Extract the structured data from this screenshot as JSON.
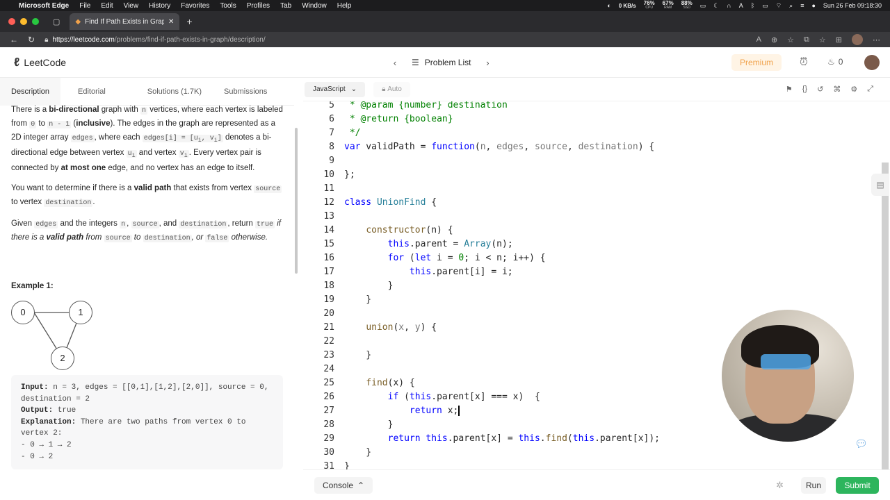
{
  "menubar": {
    "apple": "",
    "app_name": "Microsoft Edge",
    "items": [
      "File",
      "Edit",
      "View",
      "History",
      "Favorites",
      "Tools",
      "Profiles",
      "Tab",
      "Window",
      "Help"
    ],
    "stats": [
      {
        "value": "0 KB/s",
        "label": ""
      },
      {
        "value": "76%",
        "label": "CPU"
      },
      {
        "value": "67%",
        "label": "RAM"
      },
      {
        "value": "88%",
        "label": "SSD"
      }
    ],
    "clock": "Sun 26 Feb  09:18:30"
  },
  "browser": {
    "tab_title": "Find If Path Exists in Graph - L",
    "url_host": "https://leetcode.com",
    "url_path": "/problems/find-if-path-exists-in-graph/description/"
  },
  "header": {
    "logo_text": "LeetCode",
    "problem_list": "Problem List",
    "premium": "Premium",
    "streak": "0"
  },
  "left": {
    "tabs": [
      "Description",
      "Editorial",
      "Solutions (1.7K)",
      "Submissions"
    ],
    "p1": {
      "a": "There is a ",
      "b": "bi-directional",
      "c": " graph with ",
      "n": "n",
      "d": " vertices, where each vertex is labeled from ",
      "zero": "0",
      "e": " to ",
      "nm1": "n - 1",
      "f": " (",
      "incl": "inclusive",
      "g": "). The edges in the graph are represented as a 2D integer array ",
      "edges": "edges",
      "h": ", where each ",
      "edgei": "edges[i] = [u",
      "i1": "i",
      "comma": ", v",
      "i2": "i",
      "close": "]",
      "j": " denotes a bi-directional edge between vertex ",
      "u": "u",
      "ui": "i",
      "k": " and vertex ",
      "v": "v",
      "vi": "i",
      "l": ". Every vertex pair is connected by ",
      "atmost": "at most one",
      "m": " edge, and no vertex has an edge to itself."
    },
    "p2": {
      "a": "You want to determine if there is a ",
      "vp": "valid path",
      "b": " that exists from vertex ",
      "source": "source",
      "c": " to vertex ",
      "dest": "destination",
      "d": "."
    },
    "p3": {
      "a": "Given ",
      "edges": "edges",
      "b": " and the integers ",
      "n": "n",
      "c": ", ",
      "source": "source",
      "d": ", and ",
      "dest": "destination",
      "e": ", return ",
      "true": "true",
      "f": " if there is a ",
      "vp": "valid path",
      "g": " from ",
      "source2": "source",
      "h": " to ",
      "dest2": "destination",
      "i": ", or ",
      "false": "false",
      "j": " otherwise."
    },
    "example_title": "Example 1:",
    "graph_nodes": [
      "0",
      "1",
      "2"
    ],
    "io": {
      "in_label": "Input:",
      "in_val": " n = 3, edges = [[0,1],[1,2],[2,0]], source = 0, destination = 2",
      "out_label": "Output:",
      "out_val": " true",
      "exp_label": "Explanation:",
      "exp_val": " There are two paths from vertex 0 to vertex 2:",
      "path1": "- 0 → 1 → 2",
      "path2": "- 0 → 2"
    }
  },
  "editor": {
    "language": "JavaScript",
    "mode": "Auto",
    "lines": [
      {
        "n": "5",
        "parts": [
          {
            "t": " * ",
            "c": "cm"
          },
          {
            "t": "@param",
            "c": "cm"
          },
          {
            "t": " {number} destination",
            "c": "cm"
          }
        ]
      },
      {
        "n": "6",
        "parts": [
          {
            "t": " * ",
            "c": "cm"
          },
          {
            "t": "@return",
            "c": "cm"
          },
          {
            "t": " {boolean}",
            "c": "cm"
          }
        ]
      },
      {
        "n": "7",
        "parts": [
          {
            "t": " */",
            "c": "cm"
          }
        ]
      },
      {
        "n": "8",
        "parts": [
          {
            "t": "var",
            "c": "k"
          },
          {
            "t": " validPath = ",
            "c": ""
          },
          {
            "t": "function",
            "c": "k"
          },
          {
            "t": "(",
            "c": ""
          },
          {
            "t": "n",
            "c": "pa"
          },
          {
            "t": ", ",
            "c": ""
          },
          {
            "t": "edges",
            "c": "pa"
          },
          {
            "t": ", ",
            "c": ""
          },
          {
            "t": "source",
            "c": "pa"
          },
          {
            "t": ", ",
            "c": ""
          },
          {
            "t": "destination",
            "c": "pa"
          },
          {
            "t": ") {",
            "c": ""
          }
        ]
      },
      {
        "n": "9",
        "parts": []
      },
      {
        "n": "10",
        "parts": [
          {
            "t": "};",
            "c": ""
          }
        ]
      },
      {
        "n": "11",
        "parts": []
      },
      {
        "n": "12",
        "parts": [
          {
            "t": "class",
            "c": "k"
          },
          {
            "t": " ",
            "c": ""
          },
          {
            "t": "UnionFind",
            "c": "ty"
          },
          {
            "t": " {",
            "c": ""
          }
        ]
      },
      {
        "n": "13",
        "parts": []
      },
      {
        "n": "14",
        "parts": [
          {
            "t": "    ",
            "c": ""
          },
          {
            "t": "constructor",
            "c": "f"
          },
          {
            "t": "(n) {",
            "c": ""
          }
        ]
      },
      {
        "n": "15",
        "parts": [
          {
            "t": "        ",
            "c": ""
          },
          {
            "t": "this",
            "c": "k"
          },
          {
            "t": ".parent = ",
            "c": ""
          },
          {
            "t": "Array",
            "c": "ty"
          },
          {
            "t": "(n);",
            "c": ""
          }
        ]
      },
      {
        "n": "16",
        "parts": [
          {
            "t": "        ",
            "c": ""
          },
          {
            "t": "for",
            "c": "k"
          },
          {
            "t": " (",
            "c": ""
          },
          {
            "t": "let",
            "c": "k"
          },
          {
            "t": " i = ",
            "c": ""
          },
          {
            "t": "0",
            "c": "cm"
          },
          {
            "t": "; i < n; i++) {",
            "c": ""
          }
        ]
      },
      {
        "n": "17",
        "parts": [
          {
            "t": "            ",
            "c": ""
          },
          {
            "t": "this",
            "c": "k"
          },
          {
            "t": ".parent[i] = i;",
            "c": ""
          }
        ]
      },
      {
        "n": "18",
        "parts": [
          {
            "t": "        }",
            "c": ""
          }
        ]
      },
      {
        "n": "19",
        "parts": [
          {
            "t": "    }",
            "c": ""
          }
        ]
      },
      {
        "n": "20",
        "parts": []
      },
      {
        "n": "21",
        "parts": [
          {
            "t": "    ",
            "c": ""
          },
          {
            "t": "union",
            "c": "f"
          },
          {
            "t": "(",
            "c": ""
          },
          {
            "t": "x",
            "c": "pa"
          },
          {
            "t": ", ",
            "c": ""
          },
          {
            "t": "y",
            "c": "pa"
          },
          {
            "t": ") {",
            "c": ""
          }
        ]
      },
      {
        "n": "22",
        "parts": []
      },
      {
        "n": "23",
        "parts": [
          {
            "t": "    }",
            "c": ""
          }
        ]
      },
      {
        "n": "24",
        "parts": []
      },
      {
        "n": "25",
        "parts": [
          {
            "t": "    ",
            "c": ""
          },
          {
            "t": "find",
            "c": "f"
          },
          {
            "t": "(x) {",
            "c": ""
          }
        ]
      },
      {
        "n": "26",
        "parts": [
          {
            "t": "        ",
            "c": ""
          },
          {
            "t": "if",
            "c": "k"
          },
          {
            "t": " (",
            "c": ""
          },
          {
            "t": "this",
            "c": "k"
          },
          {
            "t": ".parent[x] === x)  {",
            "c": ""
          }
        ]
      },
      {
        "n": "27",
        "parts": [
          {
            "t": "            ",
            "c": ""
          },
          {
            "t": "return",
            "c": "k"
          },
          {
            "t": " x;",
            "c": ""
          }
        ]
      },
      {
        "n": "28",
        "parts": [
          {
            "t": "        }",
            "c": ""
          }
        ]
      },
      {
        "n": "29",
        "parts": [
          {
            "t": "        ",
            "c": ""
          },
          {
            "t": "return",
            "c": "k"
          },
          {
            "t": " ",
            "c": ""
          },
          {
            "t": "this",
            "c": "k"
          },
          {
            "t": ".parent[x] = ",
            "c": ""
          },
          {
            "t": "this",
            "c": "k"
          },
          {
            "t": ".",
            "c": ""
          },
          {
            "t": "find",
            "c": "f"
          },
          {
            "t": "(",
            "c": ""
          },
          {
            "t": "this",
            "c": "k"
          },
          {
            "t": ".parent[x]);",
            "c": ""
          }
        ]
      },
      {
        "n": "30",
        "parts": [
          {
            "t": "    }",
            "c": ""
          }
        ]
      },
      {
        "n": "31",
        "parts": [
          {
            "t": "}",
            "c": ""
          }
        ]
      }
    ],
    "cursor_line": "27"
  },
  "bottom": {
    "console": "Console",
    "run": "Run",
    "submit": "Submit"
  },
  "colors": {
    "submit": "#2db55d",
    "premium_text": "#f0a14a",
    "keyword": "#0000ff",
    "comment": "#008000"
  }
}
